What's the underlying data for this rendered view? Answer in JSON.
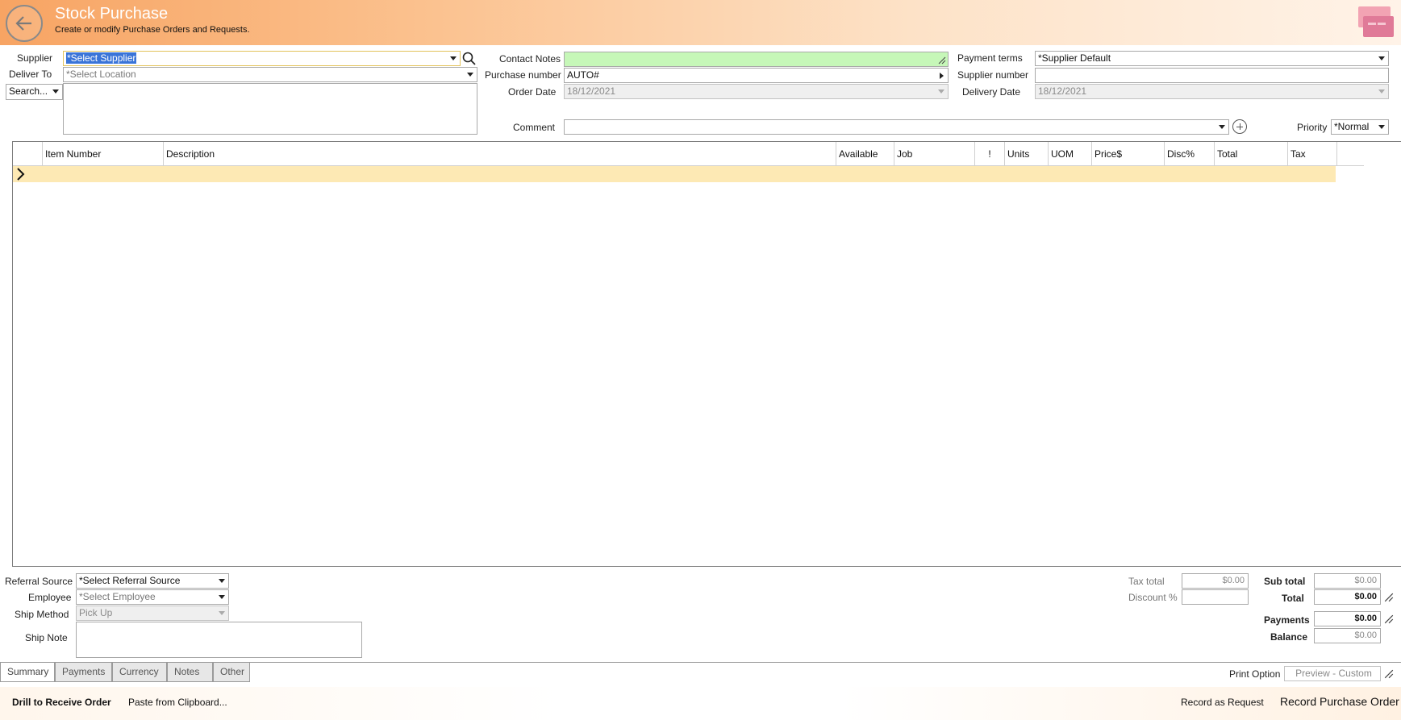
{
  "header": {
    "title": "Stock Purchase",
    "subtitle": "Create or modify Purchase Orders and Requests."
  },
  "form": {
    "supplier_label": "Supplier",
    "supplier_value": "*Select Supplier",
    "deliver_to_label": "Deliver To",
    "deliver_to_value": "*Select Location",
    "search_value": "Search...",
    "contact_notes_label": "Contact Notes",
    "contact_notes_value": "",
    "purchase_number_label": "Purchase number",
    "purchase_number_value": "AUTO#",
    "order_date_label": "Order Date",
    "order_date_value": "18/12/2021",
    "payment_terms_label": "Payment terms",
    "payment_terms_value": "*Supplier Default",
    "supplier_number_label": "Supplier number",
    "supplier_number_value": "",
    "delivery_date_label": "Delivery Date",
    "delivery_date_value": "18/12/2021",
    "comment_label": "Comment",
    "comment_value": "",
    "priority_label": "Priority",
    "priority_value": "*Normal"
  },
  "grid": {
    "columns": [
      "Item Number",
      "Description",
      "Available",
      "Job",
      "!",
      "Units",
      "UOM",
      "Price$",
      "Disc%",
      "Total",
      "Tax"
    ]
  },
  "bottom": {
    "referral_source_label": "Referral Source",
    "referral_source_value": "*Select Referral Source",
    "employee_label": "Employee",
    "employee_value": "*Select Employee",
    "ship_method_label": "Ship Method",
    "ship_method_value": "Pick Up",
    "ship_note_label": "Ship Note",
    "tax_total_label": "Tax total",
    "tax_total_value": "$0.00",
    "discount_label": "Discount %",
    "discount_value": "",
    "sub_total_label": "Sub total",
    "sub_total_value": "$0.00",
    "total_label": "Total",
    "total_value": "$0.00",
    "payments_label": "Payments",
    "payments_value": "$0.00",
    "balance_label": "Balance",
    "balance_value": "$0.00",
    "print_option_label": "Print Option",
    "print_option_value": "Preview - Custom"
  },
  "tabs": [
    "Summary",
    "Payments",
    "Currency",
    "Notes",
    "Other"
  ],
  "actions": {
    "drill": "Drill to Receive Order",
    "paste": "Paste from Clipboard...",
    "record_request": "Record as Request",
    "record_order": "Record Purchase Order"
  },
  "colors": {
    "header_accent": "#f7a463",
    "contact_notes_bg": "#c6f7b8",
    "grid_new_row": "#fde9b4",
    "selection": "#3a74d8"
  }
}
